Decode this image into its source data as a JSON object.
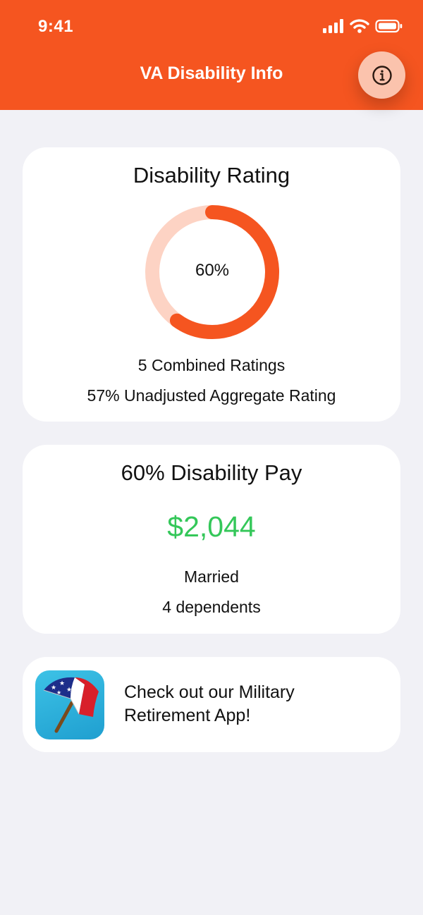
{
  "status_bar": {
    "time": "9:41",
    "icons": [
      "cellular-signal-icon",
      "wifi-icon",
      "battery-icon"
    ]
  },
  "nav": {
    "title": "VA Disability Info",
    "info_icon": "info-circle-icon"
  },
  "rating_card": {
    "title": "Disability Rating",
    "rating_percent": 60,
    "rating_label": "60%",
    "combined_ratings": "5 Combined Ratings",
    "unadjusted_rating": "57% Unadjusted Aggregate Rating"
  },
  "pay_card": {
    "title": "60% Disability Pay",
    "amount": "$2,044",
    "marital_status": "Married",
    "dependents": "4 dependents"
  },
  "promo_card": {
    "icon": "umbrella-flag-app-icon",
    "text_line1": "Check out our Military",
    "text_line2": "Retirement App!"
  },
  "colors": {
    "accent": "#f55520",
    "accent_light": "#fbc3ad",
    "ring_track": "#fdd3c4",
    "pay_green": "#34c759",
    "background": "#f1f1f6"
  }
}
